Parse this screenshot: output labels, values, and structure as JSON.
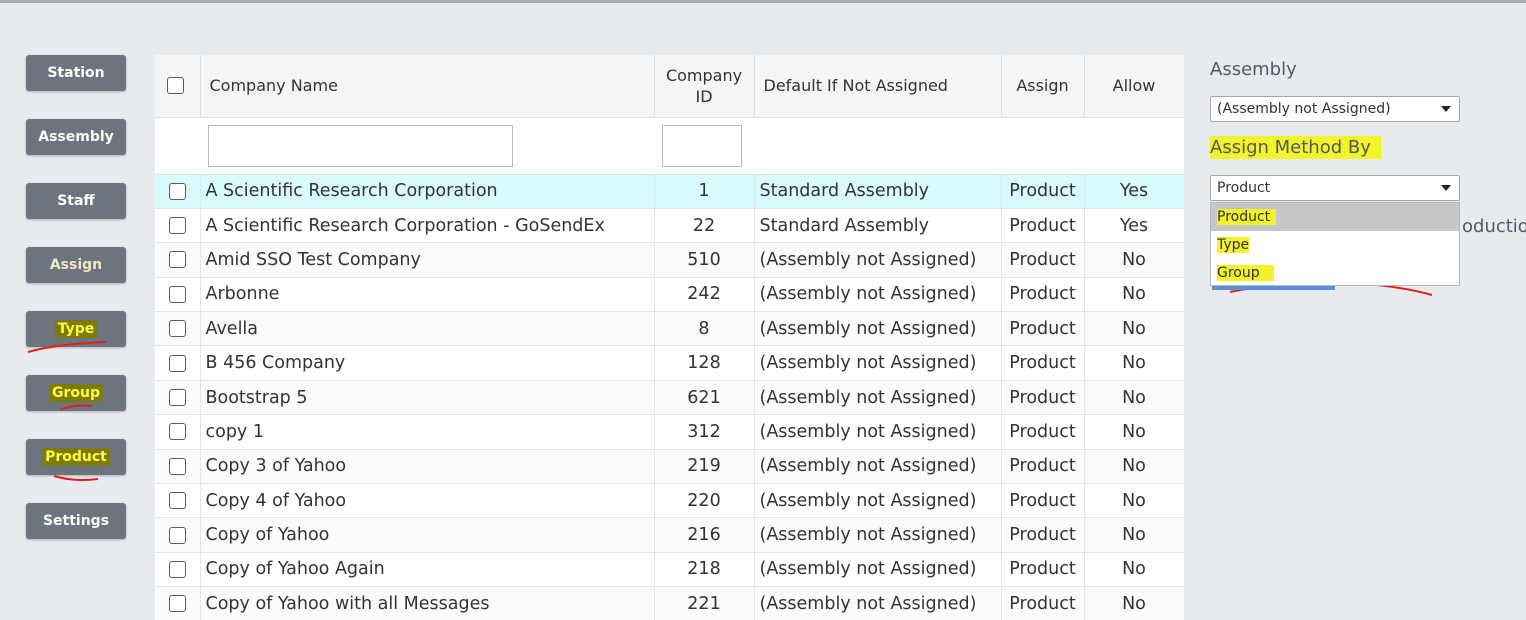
{
  "nav": {
    "station": "Station",
    "assembly": "Assembly",
    "staff": "Staff",
    "assign": "Assign",
    "type": "Type",
    "group": "Group",
    "product": "Product",
    "settings": "Settings"
  },
  "table": {
    "headers": {
      "company_name": "Company Name",
      "company_id_line1": "Company",
      "company_id_line2": "ID",
      "default": "Default If Not Assigned",
      "assign": "Assign",
      "allow": "Allow"
    },
    "rows": [
      {
        "name": "A Scientific Research Corporation",
        "id": "1",
        "default": "Standard Assembly",
        "assign": "Product",
        "allow": "Yes"
      },
      {
        "name": "A Scientific Research Corporation - GoSendEx",
        "id": "22",
        "default": "Standard Assembly",
        "assign": "Product",
        "allow": "Yes"
      },
      {
        "name": "Amid SSO Test Company",
        "id": "510",
        "default": "(Assembly not Assigned)",
        "assign": "Product",
        "allow": "No"
      },
      {
        "name": "Arbonne",
        "id": "242",
        "default": "(Assembly not Assigned)",
        "assign": "Product",
        "allow": "No"
      },
      {
        "name": "Avella",
        "id": "8",
        "default": "(Assembly not Assigned)",
        "assign": "Product",
        "allow": "No"
      },
      {
        "name": "B 456 Company",
        "id": "128",
        "default": "(Assembly not Assigned)",
        "assign": "Product",
        "allow": "No"
      },
      {
        "name": "Bootstrap 5",
        "id": "621",
        "default": "(Assembly not Assigned)",
        "assign": "Product",
        "allow": "No"
      },
      {
        "name": "copy 1",
        "id": "312",
        "default": "(Assembly not Assigned)",
        "assign": "Product",
        "allow": "No"
      },
      {
        "name": "Copy 3 of Yahoo",
        "id": "219",
        "default": "(Assembly not Assigned)",
        "assign": "Product",
        "allow": "No"
      },
      {
        "name": "Copy 4 of Yahoo",
        "id": "220",
        "default": "(Assembly not Assigned)",
        "assign": "Product",
        "allow": "No"
      },
      {
        "name": "Copy of Yahoo",
        "id": "216",
        "default": "(Assembly not Assigned)",
        "assign": "Product",
        "allow": "No"
      },
      {
        "name": "Copy of Yahoo Again",
        "id": "218",
        "default": "(Assembly not Assigned)",
        "assign": "Product",
        "allow": "No"
      },
      {
        "name": "Copy of Yahoo with all Messages",
        "id": "221",
        "default": "(Assembly not Assigned)",
        "assign": "Product",
        "allow": "No"
      }
    ]
  },
  "panel": {
    "assembly_label": "Assembly",
    "assembly_value": "(Assembly not Assigned)",
    "method_label": "Assign Method By",
    "method_value": "Product",
    "options": [
      "Product",
      "Type",
      "Group"
    ],
    "behind_text": "oduction"
  },
  "colors": {
    "nav_button": "#6c757d",
    "selected_row": "#dafbfd",
    "highlight_yellow": "#f3f32a",
    "annotation_red": "#e0201c"
  }
}
